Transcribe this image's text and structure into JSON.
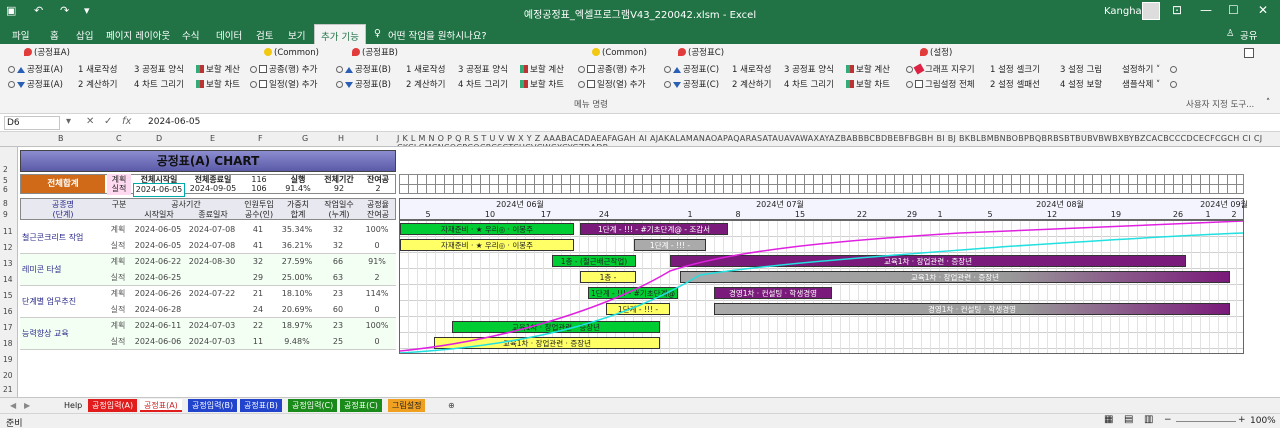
{
  "window": {
    "doc_title": "예정공정표_엑셀프로그램V43_220042.xlsm  -  Excel",
    "user": "Kangha"
  },
  "tabs": [
    "파일",
    "홈",
    "삽입",
    "페이지 레이아웃",
    "수식",
    "데이터",
    "검토",
    "보기",
    "추가 기능"
  ],
  "tellme": "어떤 작업을 원하시나요?",
  "share": "공유",
  "ribbon": {
    "g1_title": "(공정표A)",
    "g1_r1": "공정표(A)",
    "g1_r2": "공정표(A)",
    "g1_c2a": "1 새로작성",
    "g1_c2b": "2 계산하기",
    "g1_c3a": "3 공정표 양식",
    "g1_c3b": "4 차트 그리기",
    "g1_c4a": "보할 계산",
    "g1_c4b": "보할 차트",
    "g2_title": "(Common)",
    "g2_a": "공종(행) 추가",
    "g2_b": "일정(열) 추가",
    "g3_title": "(공정표B)",
    "g3_r1": "공정표(B)",
    "g3_r2": "공정표(B)",
    "g3_c2a": "1 새로작성",
    "g3_c2b": "2 계산하기",
    "g3_c3a": "3 공정표 양식",
    "g3_c3b": "4 차트 그리기",
    "g3_c4a": "보할 계산",
    "g3_c4b": "보할 차트",
    "g4_title": "(Common)",
    "g4_a": "공종(행) 추가",
    "g4_b": "일정(열) 추가",
    "g5_title": "(공정표C)",
    "g5_r1": "공정표(C)",
    "g5_r2": "공정표(C)",
    "g5_c2a": "1 새로작성",
    "g5_c2b": "2 계산하기",
    "g5_c3a": "3 공정표 양식",
    "g5_c3b": "4 차트 그리기",
    "g5_c4a": "보할 계산",
    "g5_c4b": "보할 차트",
    "g6_title": "(설정)",
    "g6_a": "그래프 지우기",
    "g6_b": "그림설정 전체",
    "g6_c": "1 설정 셀크기",
    "g6_d": "2 설정 셀패선",
    "g6_e": "3 설정 그림",
    "g6_f": "4 설정 보할",
    "g6_g": "설정하기 ˅",
    "g6_h": "샘플삭제 ˅",
    "menu_cmd": "메뉴 명령",
    "custom_tb": "사용자 지정 도구..."
  },
  "formula": {
    "namebox": "D6",
    "value": "2024-06-05"
  },
  "sheet": {
    "title": "공정표(A) CHART",
    "total_label": "전체합계",
    "plan": "계획",
    "actual": "실적",
    "hdr_start": "전체시작일",
    "hdr_end": "전체종료일",
    "hdr_num1": "116",
    "hdr_pct_lbl": "실행",
    "hdr_period_lbl": "전체기간",
    "hdr_remain_lbl": "잔여공",
    "start_val": "2024-06-05",
    "end_val": "2024-09-05",
    "v106": "106",
    "v914": "91.4%",
    "v92": "92",
    "v2": "2",
    "col_work": "공종명",
    "col_work2": "(단계)",
    "col_kind": "구분",
    "col_period": "공사기간",
    "col_start": "시작일자",
    "col_end": "종료일자",
    "col_inwon": "인원투입",
    "col_inwon2": "공수(인)",
    "col_weight": "가중치",
    "col_weight2": "합계",
    "col_days": "작업일수",
    "col_days2": "(누계)",
    "col_rate": "공정율",
    "col_rate2": "잔여공",
    "months": [
      "2024년 06월",
      "2024년 07월",
      "2024년 08월",
      "2024년 09월"
    ],
    "days": [
      "5",
      "10",
      "17",
      "24",
      "1",
      "8",
      "15",
      "22",
      "29",
      "1",
      "5",
      "12",
      "19",
      "26",
      "1",
      "2"
    ],
    "rows": [
      {
        "name": "철근콘크리트 작업",
        "p": [
          "계획",
          "2024-06-05",
          "2024-07-08",
          "41",
          "35.34%",
          "32",
          "100%"
        ],
        "a": [
          "실적",
          "2024-06-05",
          "2024-07-08",
          "41",
          "36.21%",
          "32",
          "0"
        ]
      },
      {
        "name": "레미콘 타설",
        "p": [
          "계획",
          "2024-06-22",
          "2024-08-30",
          "32",
          "27.59%",
          "66",
          "91%"
        ],
        "a": [
          "실적",
          "2024-06-25",
          "",
          "29",
          "25.00%",
          "63",
          "2"
        ]
      },
      {
        "name": "단계별 업무추진",
        "p": [
          "계획",
          "2024-06-26",
          "2024-07-22",
          "21",
          "18.10%",
          "23",
          "114%"
        ],
        "a": [
          "실적",
          "2024-06-28",
          "",
          "24",
          "20.69%",
          "60",
          "0"
        ]
      },
      {
        "name": "능력향상 교육",
        "p": [
          "계획",
          "2024-06-11",
          "2024-07-03",
          "22",
          "18.97%",
          "23",
          "100%"
        ],
        "a": [
          "실적",
          "2024-06-06",
          "2024-07-03",
          "11",
          "9.48%",
          "25",
          "0"
        ]
      }
    ],
    "bars": {
      "b1": "자재준비 · ★ 우리◎ · 이봉주",
      "b2": "1단계 - !!! - #기초단계@ - 조감서",
      "b3": "자재준비 · ★ 우리◎ · 이봉주",
      "b4": "1단계 - !!! -",
      "b5": "1층 - (철근배근작업)",
      "b6": "교육1차 · 장업관련 · 증장년",
      "b7": "1층 -",
      "b8": "교육1차 · 장업관련 · 증장년",
      "b9": "1단계 - !!! - #기초단계@",
      "b10": "경영1차 · 컨설팅 · 학생경영",
      "b11": "1단계 - !!! -",
      "b12": "경영1차 · 컨설팅 · 학생경영",
      "b13": "교육1차 · 장업관련 · 증장년",
      "b14": "교육1차 · 장업관련 · 증장년"
    }
  },
  "sheet_tabs": [
    "Help",
    "공정입력(A)",
    "공정표(A)",
    "공정입력(B)",
    "공정표(B)",
    "공정입력(C)",
    "공정표(C)",
    "그림설정"
  ],
  "status": {
    "ready": "준비",
    "zoom": "100%"
  },
  "colors": {
    "excel_green": "#217346",
    "plan_green": "#00cc33",
    "purple": "#7a1a7a",
    "gray": "#aaaaaa"
  }
}
